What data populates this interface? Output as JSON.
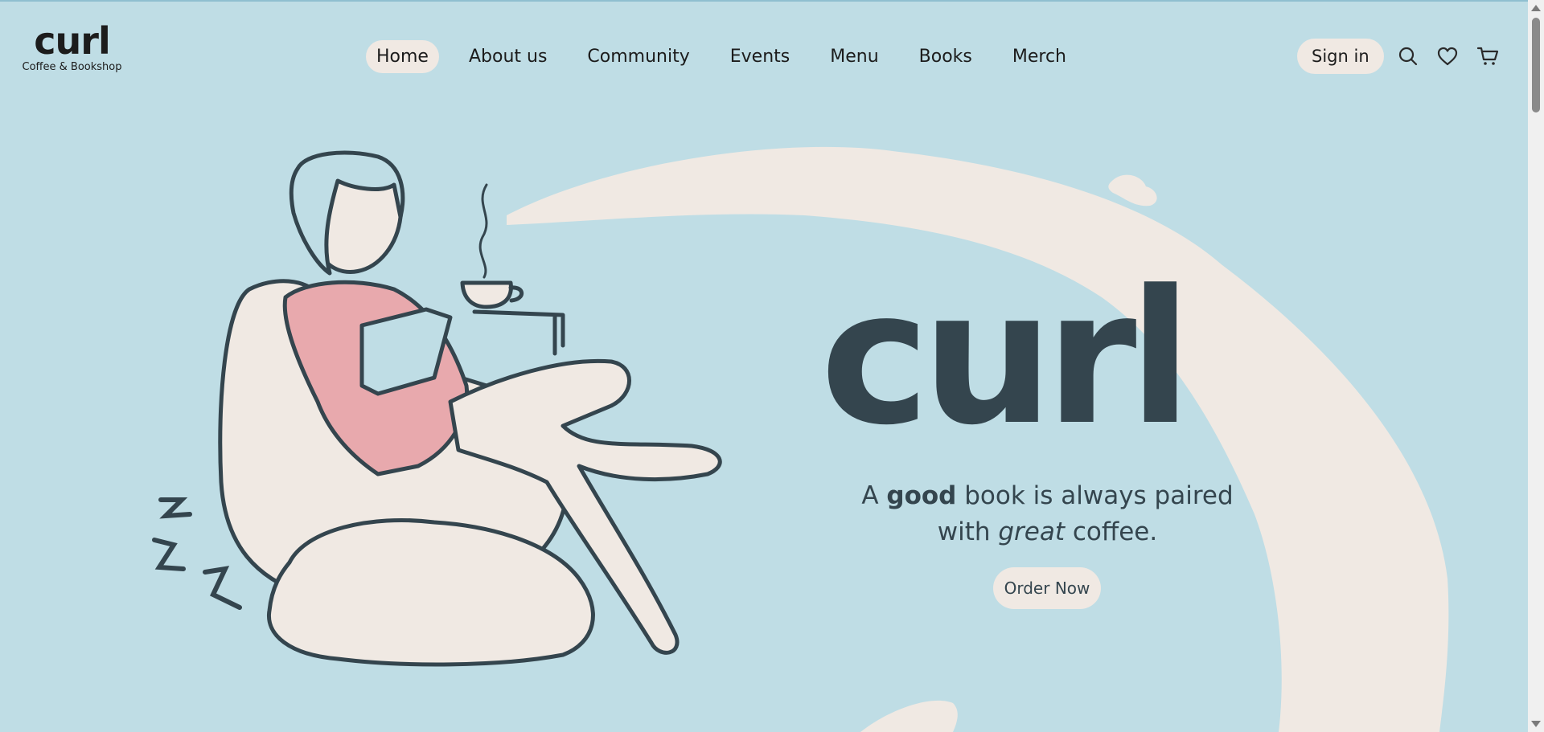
{
  "brand": {
    "logo_text": "curl",
    "tagline": "Coffee & Bookshop"
  },
  "nav": {
    "items": [
      {
        "label": "Home",
        "active": true
      },
      {
        "label": "About us",
        "active": false
      },
      {
        "label": "Community",
        "active": false
      },
      {
        "label": "Events",
        "active": false
      },
      {
        "label": "Menu",
        "active": false
      },
      {
        "label": "Books",
        "active": false
      },
      {
        "label": "Merch",
        "active": false
      }
    ]
  },
  "header": {
    "signin_label": "Sign in",
    "icons": [
      "search-icon",
      "heart-icon",
      "cart-icon"
    ]
  },
  "hero": {
    "title": "curl",
    "tagline_part1": "A ",
    "tagline_bold": "good",
    "tagline_part2": " book is always paired",
    "tagline_part3": "with ",
    "tagline_italic": "great",
    "tagline_part4": " coffee.",
    "cta_label": "Order Now"
  },
  "colors": {
    "background": "#bfdde5",
    "cream": "#f0e9e3",
    "ink": "#34454e",
    "pink": "#e8a9ad"
  }
}
